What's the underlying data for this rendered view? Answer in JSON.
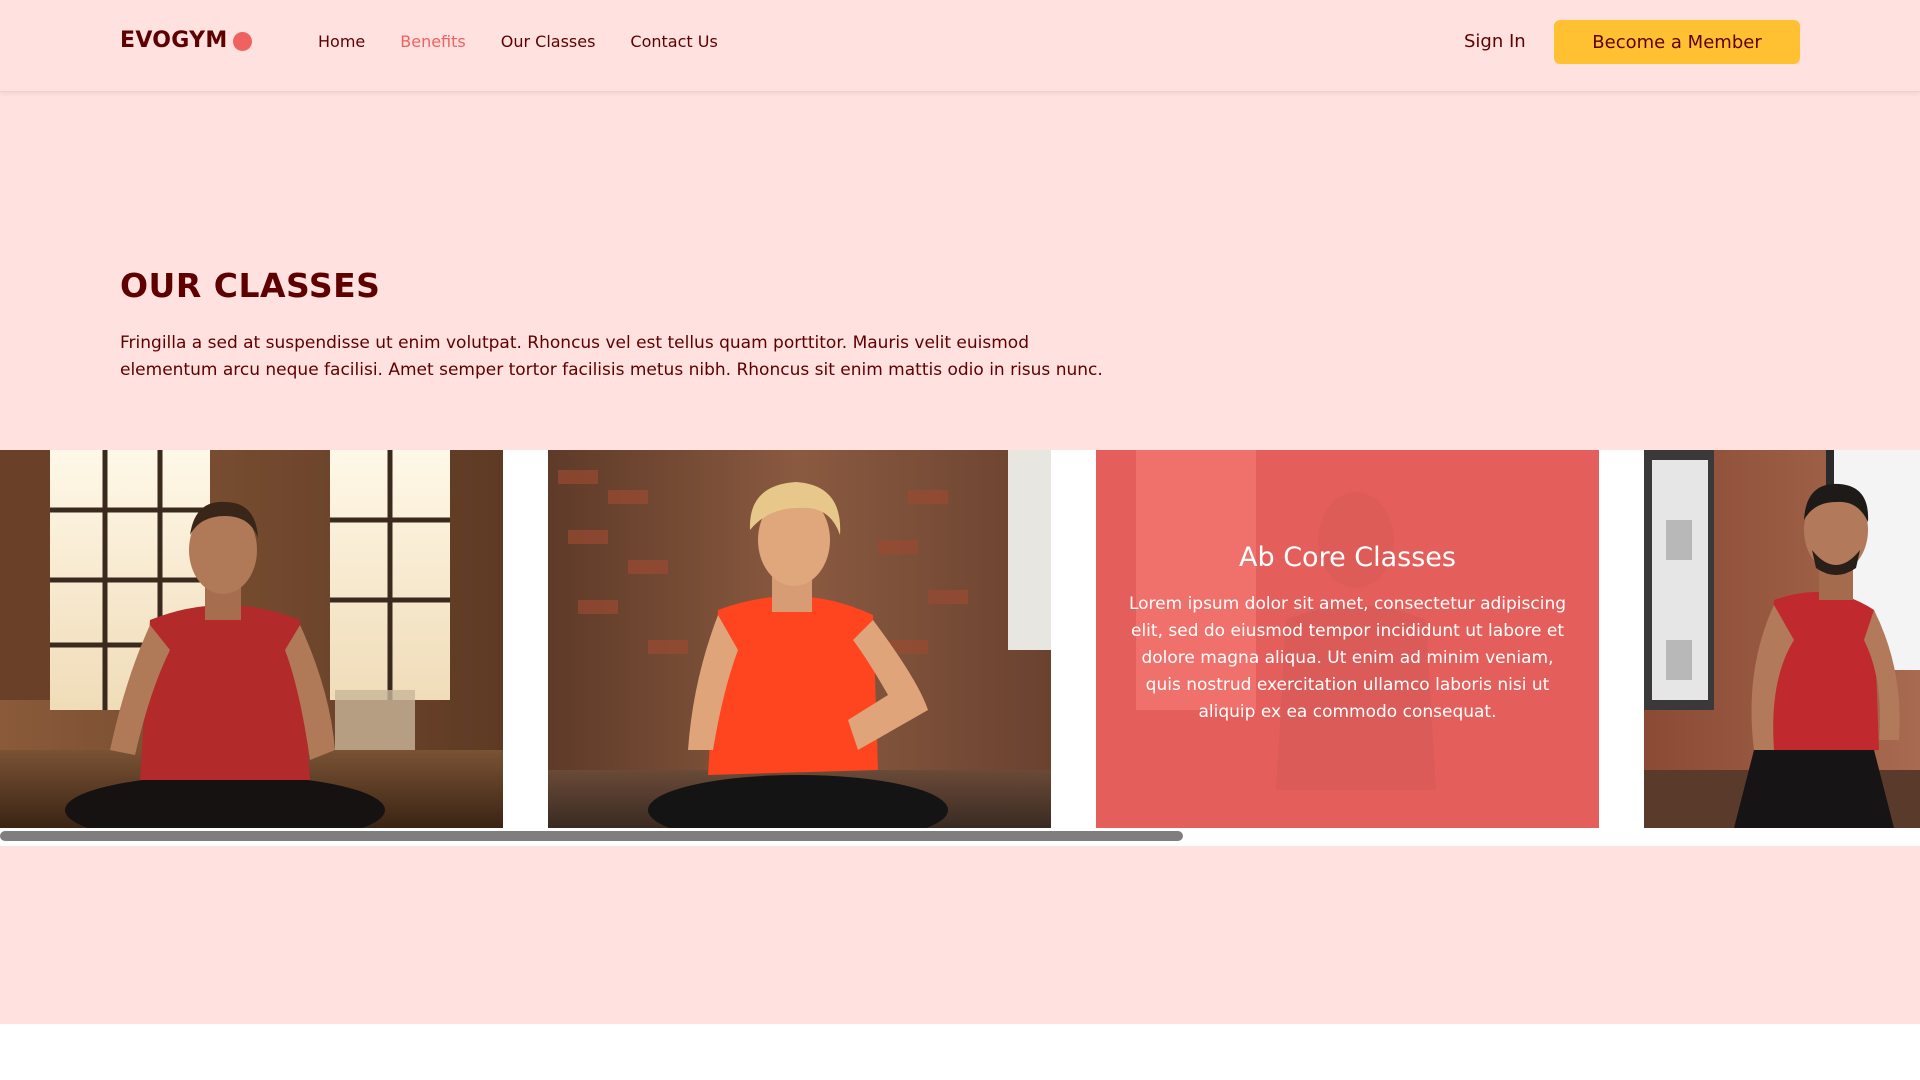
{
  "brand": {
    "name": "EVOGYM",
    "accent": "#f0625f",
    "primary_text": "#5e0000",
    "secondary": "#ffc132",
    "background": "#ffe1e0"
  },
  "nav": {
    "links": [
      {
        "label": "Home",
        "active": false
      },
      {
        "label": "Benefits",
        "active": true
      },
      {
        "label": "Our Classes",
        "active": false
      },
      {
        "label": "Contact Us",
        "active": false
      }
    ],
    "sign_in": "Sign In",
    "cta": "Become a Member"
  },
  "section": {
    "title": "OUR CLASSES",
    "description": "Fringilla a sed at suspendisse ut enim volutpat. Rhoncus vel est tellus quam porttitor. Mauris velit euismod elementum arcu neque facilisi. Amet semper tortor facilisis metus nibh. Rhoncus sit enim mattis odio in risus nunc."
  },
  "classes": [
    {
      "image": "man-in-red-tank-top-stretching-photo"
    },
    {
      "image": "blond-man-in-orange-tank-top-sitting-photo"
    },
    {
      "image": "athlete-stretching-photo",
      "title": "Ab Core Classes",
      "text": "Lorem ipsum dolor sit amet, consectetur adipiscing elit, sed do eiusmod tempor incididunt ut labore et dolore magna aliqua. Ut enim ad minim veniam, quis nostrud exercitation ullamco laboris nisi ut aliquip ex ea commodo consequat."
    },
    {
      "image": "bearded-man-lunging-photo"
    }
  ]
}
